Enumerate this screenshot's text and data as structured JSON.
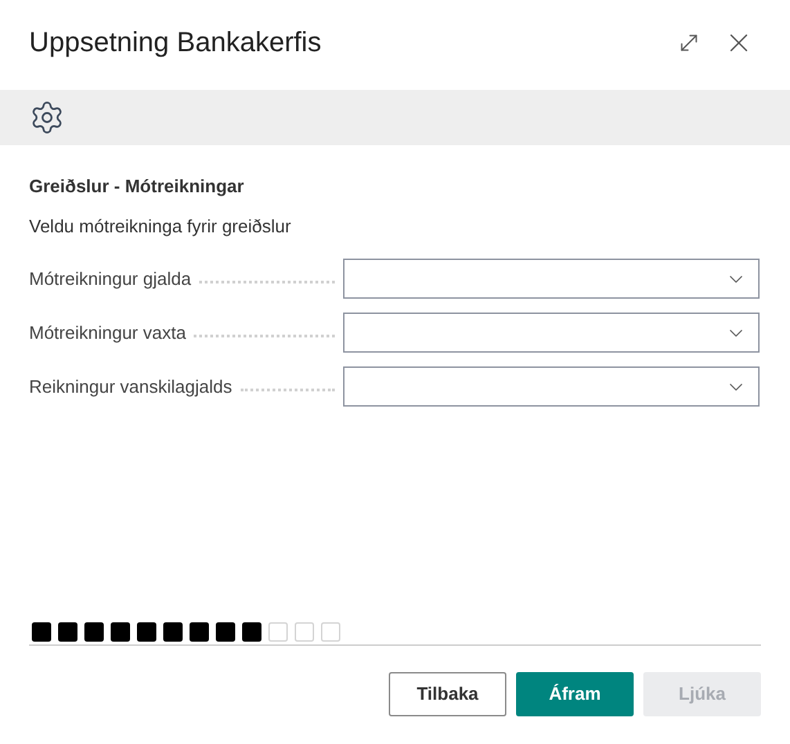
{
  "window": {
    "title": "Uppsetning Bankakerfis"
  },
  "section": {
    "heading": "Greiðslur - Mótreikningar",
    "description": "Veldu mótreikninga fyrir greiðslur"
  },
  "fields": [
    {
      "label": "Mótreikningur gjalda"
    },
    {
      "label": "Mótreikningur vaxta"
    },
    {
      "label": "Reikningur vanskilagjalds"
    }
  ],
  "progress": [
    {
      "done": true
    },
    {
      "done": true
    },
    {
      "done": true
    },
    {
      "done": true
    },
    {
      "done": true
    },
    {
      "done": true
    },
    {
      "done": true
    },
    {
      "done": true
    },
    {
      "done": true
    },
    {
      "done": false
    },
    {
      "done": false
    },
    {
      "done": false
    }
  ],
  "buttons": [
    {
      "label": "Tilbaka",
      "kind": "secondary",
      "disabled": false
    },
    {
      "label": "Áfram",
      "kind": "primary",
      "disabled": false
    },
    {
      "label": "Ljúka",
      "kind": "secondary",
      "disabled": true
    }
  ]
}
